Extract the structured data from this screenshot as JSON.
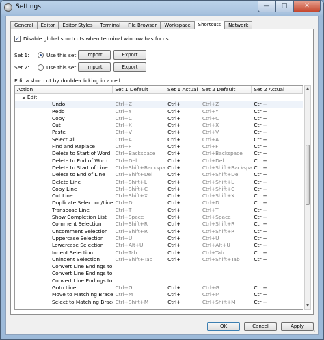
{
  "window": {
    "title": "Settings"
  },
  "tabs": [
    "General",
    "Editor",
    "Editor Styles",
    "Terminal",
    "File Browser",
    "Workspace",
    "Shortcuts",
    "Network"
  ],
  "active_tab": "Shortcuts",
  "disable_global": {
    "label": "Disable global shortcuts when terminal window has focus",
    "checked": true
  },
  "sets": [
    {
      "label": "Set 1:",
      "radio_label": "Use this set",
      "selected": true,
      "import": "Import",
      "export": "Export"
    },
    {
      "label": "Set 2:",
      "radio_label": "Use this set",
      "selected": false,
      "import": "Import",
      "export": "Export"
    }
  ],
  "help_text": "Edit a shortcut by double-clicking in a cell",
  "table": {
    "columns": [
      "Action",
      "Set 1 Default",
      "Set 1 Actual",
      "Set 2 Default",
      "Set 2 Actual"
    ],
    "group": "Edit",
    "rows": [
      [
        "Undo",
        "Ctrl+Z",
        "Ctrl+",
        "Ctrl+Z",
        "Ctrl+"
      ],
      [
        "Redo",
        "Ctrl+Y",
        "Ctrl+",
        "Ctrl+Y",
        "Ctrl+"
      ],
      [
        "Copy",
        "Ctrl+C",
        "Ctrl+",
        "Ctrl+C",
        "Ctrl+"
      ],
      [
        "Cut",
        "Ctrl+X",
        "Ctrl+",
        "Ctrl+X",
        "Ctrl+"
      ],
      [
        "Paste",
        "Ctrl+V",
        "Ctrl+",
        "Ctrl+V",
        "Ctrl+"
      ],
      [
        "Select All",
        "Ctrl+A",
        "Ctrl+",
        "Ctrl+A",
        "Ctrl+"
      ],
      [
        "Find and Replace",
        "Ctrl+F",
        "Ctrl+",
        "Ctrl+F",
        "Ctrl+"
      ],
      [
        "Delete to Start of Word",
        "Ctrl+Backspace",
        "Ctrl+",
        "Ctrl+Backspace",
        "Ctrl+"
      ],
      [
        "Delete to End of Word",
        "Ctrl+Del",
        "Ctrl+",
        "Ctrl+Del",
        "Ctrl+"
      ],
      [
        "Delete to Start of Line",
        "Ctrl+Shift+Backspace",
        "Ctrl+",
        "Ctrl+Shift+Backspace",
        "Ctrl+"
      ],
      [
        "Delete to End of Line",
        "Ctrl+Shift+Del",
        "Ctrl+",
        "Ctrl+Shift+Del",
        "Ctrl+"
      ],
      [
        "Delete Line",
        "Ctrl+Shift+L",
        "Ctrl+",
        "Ctrl+Shift+L",
        "Ctrl+"
      ],
      [
        "Copy Line",
        "Ctrl+Shift+C",
        "Ctrl+",
        "Ctrl+Shift+C",
        "Ctrl+"
      ],
      [
        "Cut Line",
        "Ctrl+Shift+X",
        "Ctrl+",
        "Ctrl+Shift+X",
        "Ctrl+"
      ],
      [
        "Duplicate Selection/Line",
        "Ctrl+D",
        "Ctrl+",
        "Ctrl+D",
        "Ctrl+"
      ],
      [
        "Transpose Line",
        "Ctrl+T",
        "Ctrl+",
        "Ctrl+T",
        "Ctrl+"
      ],
      [
        "Show Completion List",
        "Ctrl+Space",
        "Ctrl+",
        "Ctrl+Space",
        "Ctrl+"
      ],
      [
        "Comment Selection",
        "Ctrl+Shift+R",
        "Ctrl+",
        "Ctrl+Shift+R",
        "Ctrl+"
      ],
      [
        "Uncomment Selection",
        "Ctrl+Shift+R",
        "Ctrl+",
        "Ctrl+Shift+R",
        "Ctrl+"
      ],
      [
        "Uppercase Selection",
        "Ctrl+U",
        "Ctrl+",
        "Ctrl+U",
        "Ctrl+"
      ],
      [
        "Lowercase Selection",
        "Ctrl+Alt+U",
        "Ctrl+",
        "Ctrl+Alt+U",
        "Ctrl+"
      ],
      [
        "Indent Selection",
        "Ctrl+Tab",
        "Ctrl+",
        "Ctrl+Tab",
        "Ctrl+"
      ],
      [
        "Unindent Selection",
        "Ctrl+Shift+Tab",
        "Ctrl+",
        "Ctrl+Shift+Tab",
        "Ctrl+"
      ],
      [
        "Convert Line Endings to Windows",
        "",
        "",
        "",
        ""
      ],
      [
        "Convert Line Endings to Unix",
        "",
        "",
        "",
        ""
      ],
      [
        "Convert Line Endings to Mac",
        "",
        "",
        "",
        ""
      ],
      [
        "Goto Line",
        "Ctrl+G",
        "Ctrl+",
        "Ctrl+G",
        "Ctrl+"
      ],
      [
        "Move to Matching Brace",
        "Ctrl+M",
        "Ctrl+",
        "Ctrl+M",
        "Ctrl+"
      ],
      [
        "Select to Matching Brace",
        "Ctrl+Shift+M",
        "Ctrl+",
        "Ctrl+Shift+M",
        "Ctrl+"
      ]
    ]
  },
  "footer": {
    "ok": "OK",
    "cancel": "Cancel",
    "apply": "Apply"
  }
}
